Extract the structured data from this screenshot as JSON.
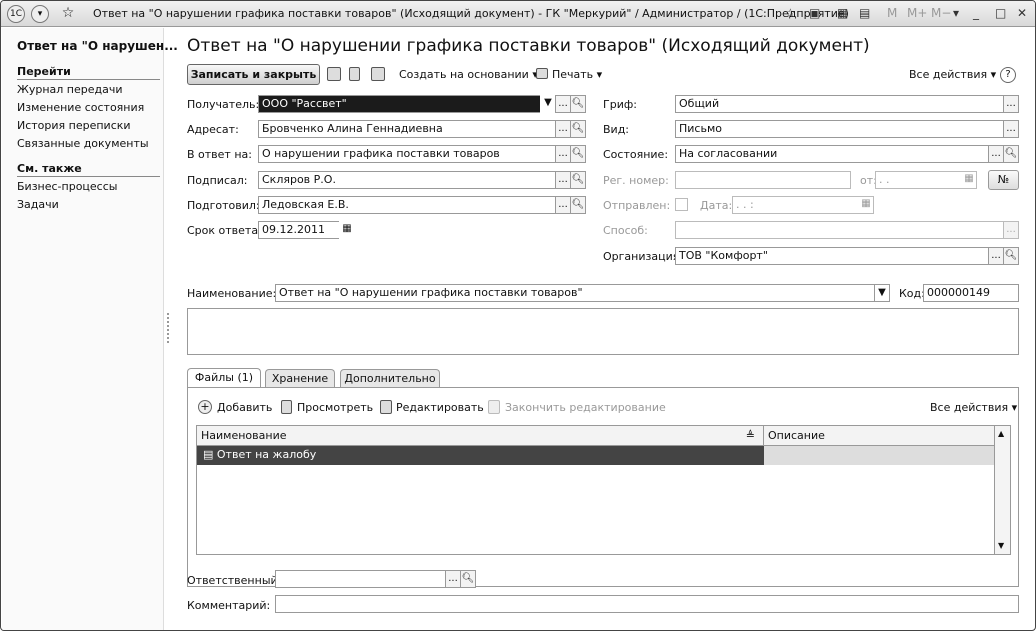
{
  "titlebar": {
    "title": "Ответ на \"О нарушении графика поставки товаров\" (Исходящий документ) - ГК \"Меркурий\" / Администратор /  (1С:Предприятие)",
    "logo": "1С",
    "right_labels": [
      "M",
      "M+",
      "M−"
    ]
  },
  "sidebar": {
    "title": "Ответ на \"О нарушен...",
    "go_header": "Перейти",
    "go_items": [
      "Журнал передачи",
      "Изменение состояния",
      "История переписки",
      "Связанные документы"
    ],
    "see_header": "См. также",
    "see_items": [
      "Бизнес-процессы",
      "Задачи"
    ]
  },
  "page": {
    "title": "Ответ на \"О нарушении графика поставки товаров\" (Исходящий документ)"
  },
  "toolbar": {
    "save_close": "Записать и закрыть",
    "create_based": "Создать на основании",
    "print": "Печать",
    "all_actions": "Все действия",
    "help": "?"
  },
  "left_form": {
    "recipient_label": "Получатель:",
    "recipient_value": "ООО \"Рассвет\"",
    "addressee_label": "Адресат:",
    "addressee_value": "Бровченко Алина Геннадиевна",
    "reply_to_label": "В ответ на:",
    "reply_to_value": "О нарушении графика поставки товаров",
    "signed_label": "Подписал:",
    "signed_value": "Скляров Р.О.",
    "prepared_label": "Подготовил:",
    "prepared_value": "Ледовская Е.В.",
    "deadline_label": "Срок ответа:",
    "deadline_value": "09.12.2011"
  },
  "right_form": {
    "stamp_label": "Гриф:",
    "stamp_value": "Общий",
    "type_label": "Вид:",
    "type_value": "Письмо",
    "state_label": "Состояние:",
    "state_value": "На согласовании",
    "regnum_label": "Рег. номер:",
    "from_label": "от:",
    "from_value": " .  .",
    "num_button": "№",
    "sent_label": "Отправлен:",
    "date_label": "Дата:",
    "date_value": " .  .     :",
    "method_label": "Способ:",
    "org_label": "Организация:",
    "org_value": "ТОВ \"Комфорт\""
  },
  "name_row": {
    "label": "Наименование:",
    "value": "Ответ на \"О нарушении графика поставки товаров\"",
    "code_label": "Код:",
    "code_value": "000000149"
  },
  "tabs": [
    {
      "label": "Файлы (1)",
      "active": true
    },
    {
      "label": "Хранение",
      "active": false
    },
    {
      "label": "Дополнительно",
      "active": false
    }
  ],
  "files_toolbar": {
    "add": "Добавить",
    "view": "Просмотреть",
    "edit": "Редактировать",
    "finish_edit": "Закончить редактирование",
    "all_actions": "Все действия"
  },
  "files_grid": {
    "columns": [
      "Наименование",
      "Описание"
    ],
    "rows": [
      {
        "name": "Ответ на жалобу",
        "description": ""
      }
    ]
  },
  "bottom": {
    "responsible_label": "Ответственный:",
    "comment_label": "Комментарий:"
  }
}
